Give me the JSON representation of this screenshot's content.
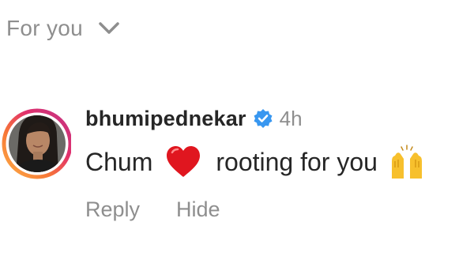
{
  "filter": {
    "label": "For you",
    "icon": "chevron-down-icon"
  },
  "comment": {
    "avatar_icon": "avatar",
    "story_ring_colors": [
      "#c13584",
      "#e1306c",
      "#f77737",
      "#fcaf45"
    ],
    "username": "bhumipednekar",
    "verified_icon": "verified-badge-icon",
    "verified_color": "#3897f0",
    "time": "4h",
    "text_before": "Chum",
    "emoji_1": "heart-emoji-icon",
    "text_after": "rooting for you",
    "emoji_2": "raising-hands-emoji-icon",
    "actions": {
      "reply_label": "Reply",
      "hide_label": "Hide"
    }
  }
}
